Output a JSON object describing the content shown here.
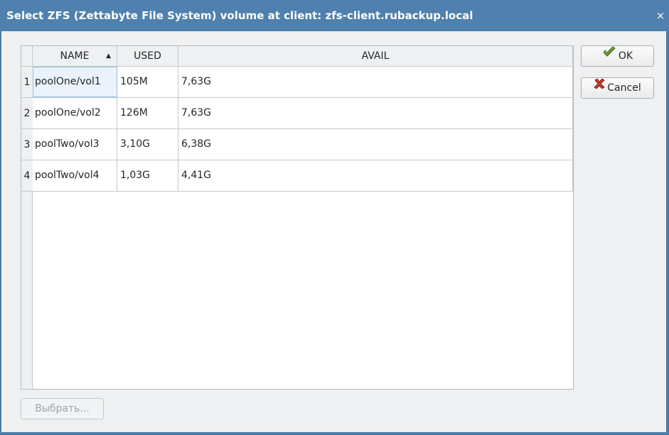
{
  "window": {
    "title": "Select ZFS (Zettabyte File System) volume at client: zfs-client.rubackup.local",
    "close_glyph": "×"
  },
  "table": {
    "columns": [
      {
        "label": "NAME",
        "sorted": "ascending"
      },
      {
        "label": "USED"
      },
      {
        "label": "AVAIL"
      }
    ],
    "sort_glyph": "▲",
    "rows": [
      {
        "num": "1",
        "name": "poolOne/vol1",
        "used": "105M",
        "avail": "7,63G"
      },
      {
        "num": "2",
        "name": "poolOne/vol2",
        "used": "126M",
        "avail": "7,63G"
      },
      {
        "num": "3",
        "name": "poolTwo/vol3",
        "used": "3,10G",
        "avail": "6,38G"
      },
      {
        "num": "4",
        "name": "poolTwo/vol4",
        "used": "1,03G",
        "avail": "4,41G"
      }
    ]
  },
  "buttons": {
    "ok": {
      "label": "OK",
      "icon": "checkmark-icon"
    },
    "cancel": {
      "label": "Cancel",
      "icon": "cross-icon"
    },
    "select": {
      "label": "Выбрать...",
      "disabled": true
    }
  },
  "colors": {
    "titlebar": "#4f80ae",
    "focused_cell": "#eaf3fb"
  }
}
